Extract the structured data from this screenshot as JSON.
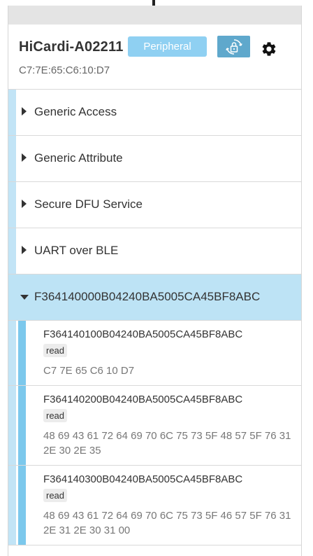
{
  "device": {
    "name": "HiCardi-A02211",
    "role_label": "Peripheral",
    "address": "C7:7E:65:C6:10:D7"
  },
  "icons": {
    "bond": "bond-lock-icon",
    "settings": "gear-icon",
    "collapsed": "caret-right-icon",
    "expanded": "caret-down-icon"
  },
  "colors": {
    "role_badge": "#8fd0f2",
    "bond_button": "#5fa8cc",
    "expanded_service": "#bde3f5",
    "characteristic_bar": "#7cc8ec"
  },
  "services": [
    {
      "name": "Generic Access",
      "expanded": false
    },
    {
      "name": "Generic Attribute",
      "expanded": false
    },
    {
      "name": "Secure DFU Service",
      "expanded": false
    },
    {
      "name": "UART over BLE",
      "expanded": false
    },
    {
      "name": "F364140000B04240BA5005CA45BF8ABC",
      "expanded": true
    }
  ],
  "characteristics": [
    {
      "uuid": "F364140100B04240BA5005CA45BF8ABC",
      "property": "read",
      "value": "C7 7E 65 C6 10 D7"
    },
    {
      "uuid": "F364140200B04240BA5005CA45BF8ABC",
      "property": "read",
      "value": "48 69 43 61 72 64 69 70 6C 75 73 5F 48 57 5F 76 31 2E 30 2E 35"
    },
    {
      "uuid": "F364140300B04240BA5005CA45BF8ABC",
      "property": "read",
      "value": "48 69 43 61 72 64 69 70 6C 75 73 5F 46 57 5F 76 31 2E 31 2E 30 31 00"
    }
  ]
}
